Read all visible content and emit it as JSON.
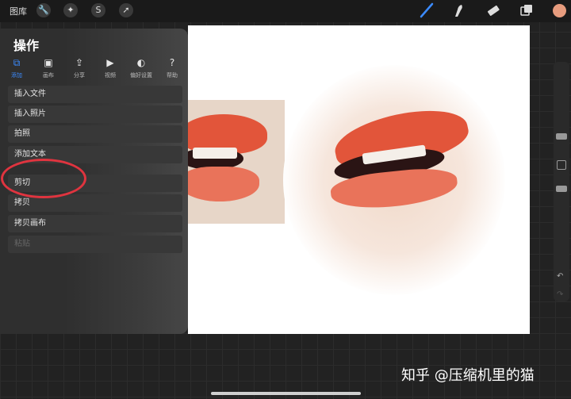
{
  "topbar": {
    "gallery_label": "图库",
    "accent_color": "#3b8bff",
    "current_color": "#e79c7e",
    "icons": [
      "wrench-icon",
      "magic-wand-icon",
      "selection-s-icon",
      "transform-arrow-icon",
      "brush-icon",
      "smudge-icon",
      "eraser-icon",
      "layers-icon"
    ]
  },
  "actions_panel": {
    "title": "操作",
    "tabs": [
      {
        "label": "添加",
        "icon": "add-icon",
        "active": true
      },
      {
        "label": "画布",
        "icon": "canvas-icon",
        "active": false
      },
      {
        "label": "分享",
        "icon": "share-icon",
        "active": false
      },
      {
        "label": "视频",
        "icon": "video-icon",
        "active": false
      },
      {
        "label": "偏好设置",
        "icon": "prefs-toggle-icon",
        "active": false
      },
      {
        "label": "帮助",
        "icon": "help-icon",
        "active": false
      }
    ],
    "menu_items": [
      {
        "label": "插入文件",
        "enabled": true
      },
      {
        "label": "插入照片",
        "enabled": true
      },
      {
        "label": "拍照",
        "enabled": true
      },
      {
        "label": "添加文本",
        "enabled": true
      },
      {
        "label": "剪切",
        "enabled": true
      },
      {
        "label": "拷贝",
        "enabled": true
      },
      {
        "label": "拷贝画布",
        "enabled": true
      },
      {
        "label": "粘贴",
        "enabled": false
      }
    ],
    "highlight_color": "#e0343f"
  },
  "sidebar": {
    "undo_icon": "undo-icon",
    "redo_icon": "redo-icon"
  },
  "watermark": "知乎 @压缩机里的猫"
}
